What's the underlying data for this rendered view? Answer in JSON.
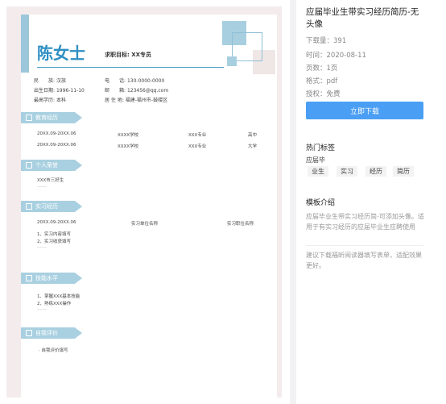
{
  "resume": {
    "name": "陈女士",
    "objective": "求职目标: XX专员",
    "info": [
      {
        "label": "民　　族:",
        "value": "汉族"
      },
      {
        "label": "出生日期:",
        "value": "1996-11-10"
      },
      {
        "label": "最高学历:",
        "value": "本科"
      },
      {
        "label": "电　　话:",
        "value": "130-0000-0000"
      },
      {
        "label": "邮　　箱:",
        "value": "123456@qq.com"
      },
      {
        "label": "居 住 地:",
        "value": "福建-福州市-鼓楼区"
      }
    ],
    "sections": {
      "education": "教育经历",
      "honors": "个人荣誉",
      "experience": "实习经历",
      "skills": "技能水平",
      "evaluation": "自我评价"
    },
    "education_rows": [
      [
        "20XX.09-20XX.06",
        "XXXX学校",
        "XXX专业",
        "高中"
      ],
      [
        "20XX.09-20XX.06",
        "XXXX学校",
        "XXX专业",
        "大学"
      ]
    ],
    "honor_item": "XXX市三好生",
    "experience_row": [
      "20XX.09-20XX.06",
      "实习单位名称",
      "实习职位名称"
    ],
    "experience_items": [
      "1、实习内容填写",
      "2、实习收获填写"
    ],
    "skill_items": [
      "1、掌握XXX基本技能",
      "2、熟练XXX操作"
    ],
    "evaluation_item": "· 自我评价填写",
    "ellipsis": "……"
  },
  "side": {
    "title": "应届毕业生带实习经历简历-无头像",
    "downloads": "下载量：391",
    "date": "时间：2020-08-11",
    "pages": "页数：1页",
    "format": "格式：pdf",
    "license": "授权：免费",
    "download_button": "立即下载",
    "tags_title": "热门标签",
    "tags": [
      "应届毕",
      "业生",
      "实习",
      "经历",
      "简历"
    ],
    "intro_title": "模板介绍",
    "intro_text": "应届毕业生带实习经历简-可添加头像。适用于有实习经历的应届毕业生应聘使用",
    "intro_note": "建议下载福昕阅读器填写表单，适配效果更好。"
  }
}
